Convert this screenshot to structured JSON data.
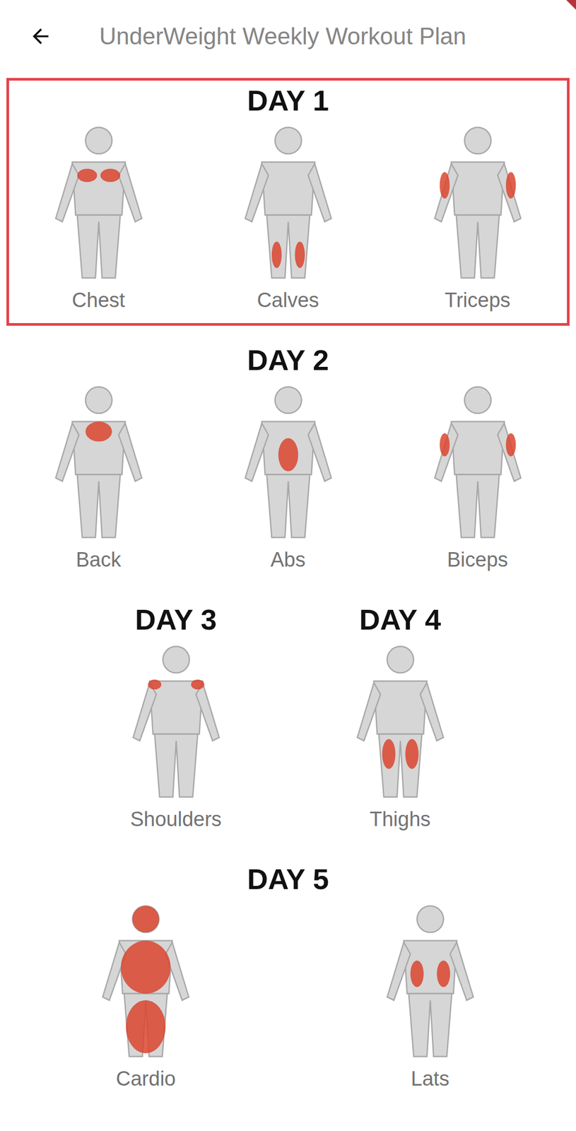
{
  "header": {
    "title": "UnderWeight Weekly Workout Plan"
  },
  "rows": [
    {
      "days": [
        {
          "label": "DAY 1",
          "selected": true,
          "muscles": [
            {
              "name": "Chest"
            },
            {
              "name": "Calves"
            },
            {
              "name": "Triceps"
            }
          ]
        }
      ]
    },
    {
      "days": [
        {
          "label": "DAY 2",
          "selected": false,
          "muscles": [
            {
              "name": "Back"
            },
            {
              "name": "Abs"
            },
            {
              "name": "Biceps"
            }
          ]
        }
      ]
    },
    {
      "days": [
        {
          "label": "DAY 3",
          "selected": false,
          "muscles": [
            {
              "name": "Shoulders"
            }
          ]
        },
        {
          "label": "DAY 4",
          "selected": false,
          "muscles": [
            {
              "name": "Thighs"
            }
          ]
        }
      ]
    },
    {
      "days": [
        {
          "label": "DAY 5",
          "selected": false,
          "muscles": [
            {
              "name": "Cardio"
            },
            {
              "name": "Lats"
            }
          ]
        }
      ]
    }
  ]
}
